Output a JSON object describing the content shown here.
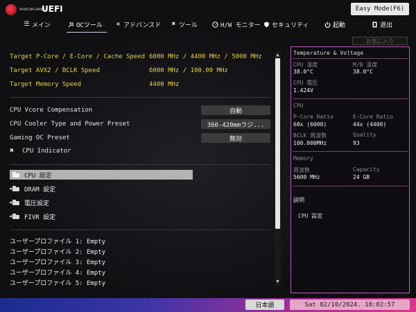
{
  "header": {
    "logo_sub": "PHANTOM GAMING",
    "logo_uefi": "UEFI",
    "easy_mode_label": "Easy Mode(F6)"
  },
  "nav": {
    "items": [
      {
        "label": "メイン",
        "icon": "list-icon"
      },
      {
        "label": "OCツール",
        "icon": "rocket-icon"
      },
      {
        "label": "アドバンスド",
        "icon": "star-icon"
      },
      {
        "label": "ツール",
        "icon": "tools-icon"
      },
      {
        "label": "H/W モニター",
        "icon": "monitor-icon"
      },
      {
        "label": "セキュリティ",
        "icon": "shield-icon"
      },
      {
        "label": "起動",
        "icon": "power-icon"
      },
      {
        "label": "退出",
        "icon": "exit-icon"
      }
    ],
    "active_index": 1
  },
  "help_button_label": "お気に入り",
  "targets": [
    {
      "label": "Target P-Core / E-Core / Cache Speed",
      "value": "6000 MHz / 4400 MHz / 5000 MHz"
    },
    {
      "label": "Target AVX2 / BCLK Speed",
      "value": "6000 MHz / 100.00 MHz"
    },
    {
      "label": "Target Memory Speed",
      "value": "4400 MHz"
    }
  ],
  "settings": [
    {
      "label": "CPU Vcore Compensation",
      "value": "自動"
    },
    {
      "label": "CPU Cooler Type and Power Preset",
      "value": "360-420mmラジ..."
    },
    {
      "label": "Gaming OC Preset",
      "value": "無効"
    },
    {
      "label": "CPU Indicator",
      "value": ""
    }
  ],
  "folders": [
    {
      "label": "CPU 設定",
      "selected": true
    },
    {
      "label": "DRAM 設定",
      "selected": false
    },
    {
      "label": "電圧設定",
      "selected": false
    },
    {
      "label": "FIVR 設定",
      "selected": false
    }
  ],
  "profiles": [
    "ユーザープロファイル 1: Empty",
    "ユーザープロファイル 2: Empty",
    "ユーザープロファイル 3: Empty",
    "ユーザープロファイル 4: Empty",
    "ユーザープロファイル 5: Empty"
  ],
  "panel": {
    "title": "Temperature & Voltage",
    "cpu_temp_label": "CPU 温度",
    "cpu_temp": "38.0°C",
    "mb_temp_label": "M/B 温度",
    "mb_temp": "38.0°C",
    "cpu_volt_label": "CPU 電圧",
    "cpu_volt": "1.424V",
    "cpu_section": "CPU",
    "pcore_ratio_label": "P-Core Ratio",
    "pcore_ratio": "60x (6000)",
    "ecore_ratio_label": "E-Core Ratio",
    "ecore_ratio": "44x (4400)",
    "bclk_label": "BCLK 周波数",
    "bclk": "100.000MHz",
    "quality_label": "Quality",
    "quality": "93",
    "memory_section": "Memory",
    "freq_label": "周波数",
    "freq": "5600 MHz",
    "capacity_label": "Capacity",
    "capacity": "24 GB",
    "desc_title": "説明",
    "desc_text": "CPU 設定"
  },
  "footer": {
    "language": "日本語",
    "datetime": "Sat 02/10/2024. 18:02:57"
  },
  "colors": {
    "target_text": "#e8d24a",
    "panel_border": "#c25ab8",
    "selected_row": "#b3b3b3"
  }
}
